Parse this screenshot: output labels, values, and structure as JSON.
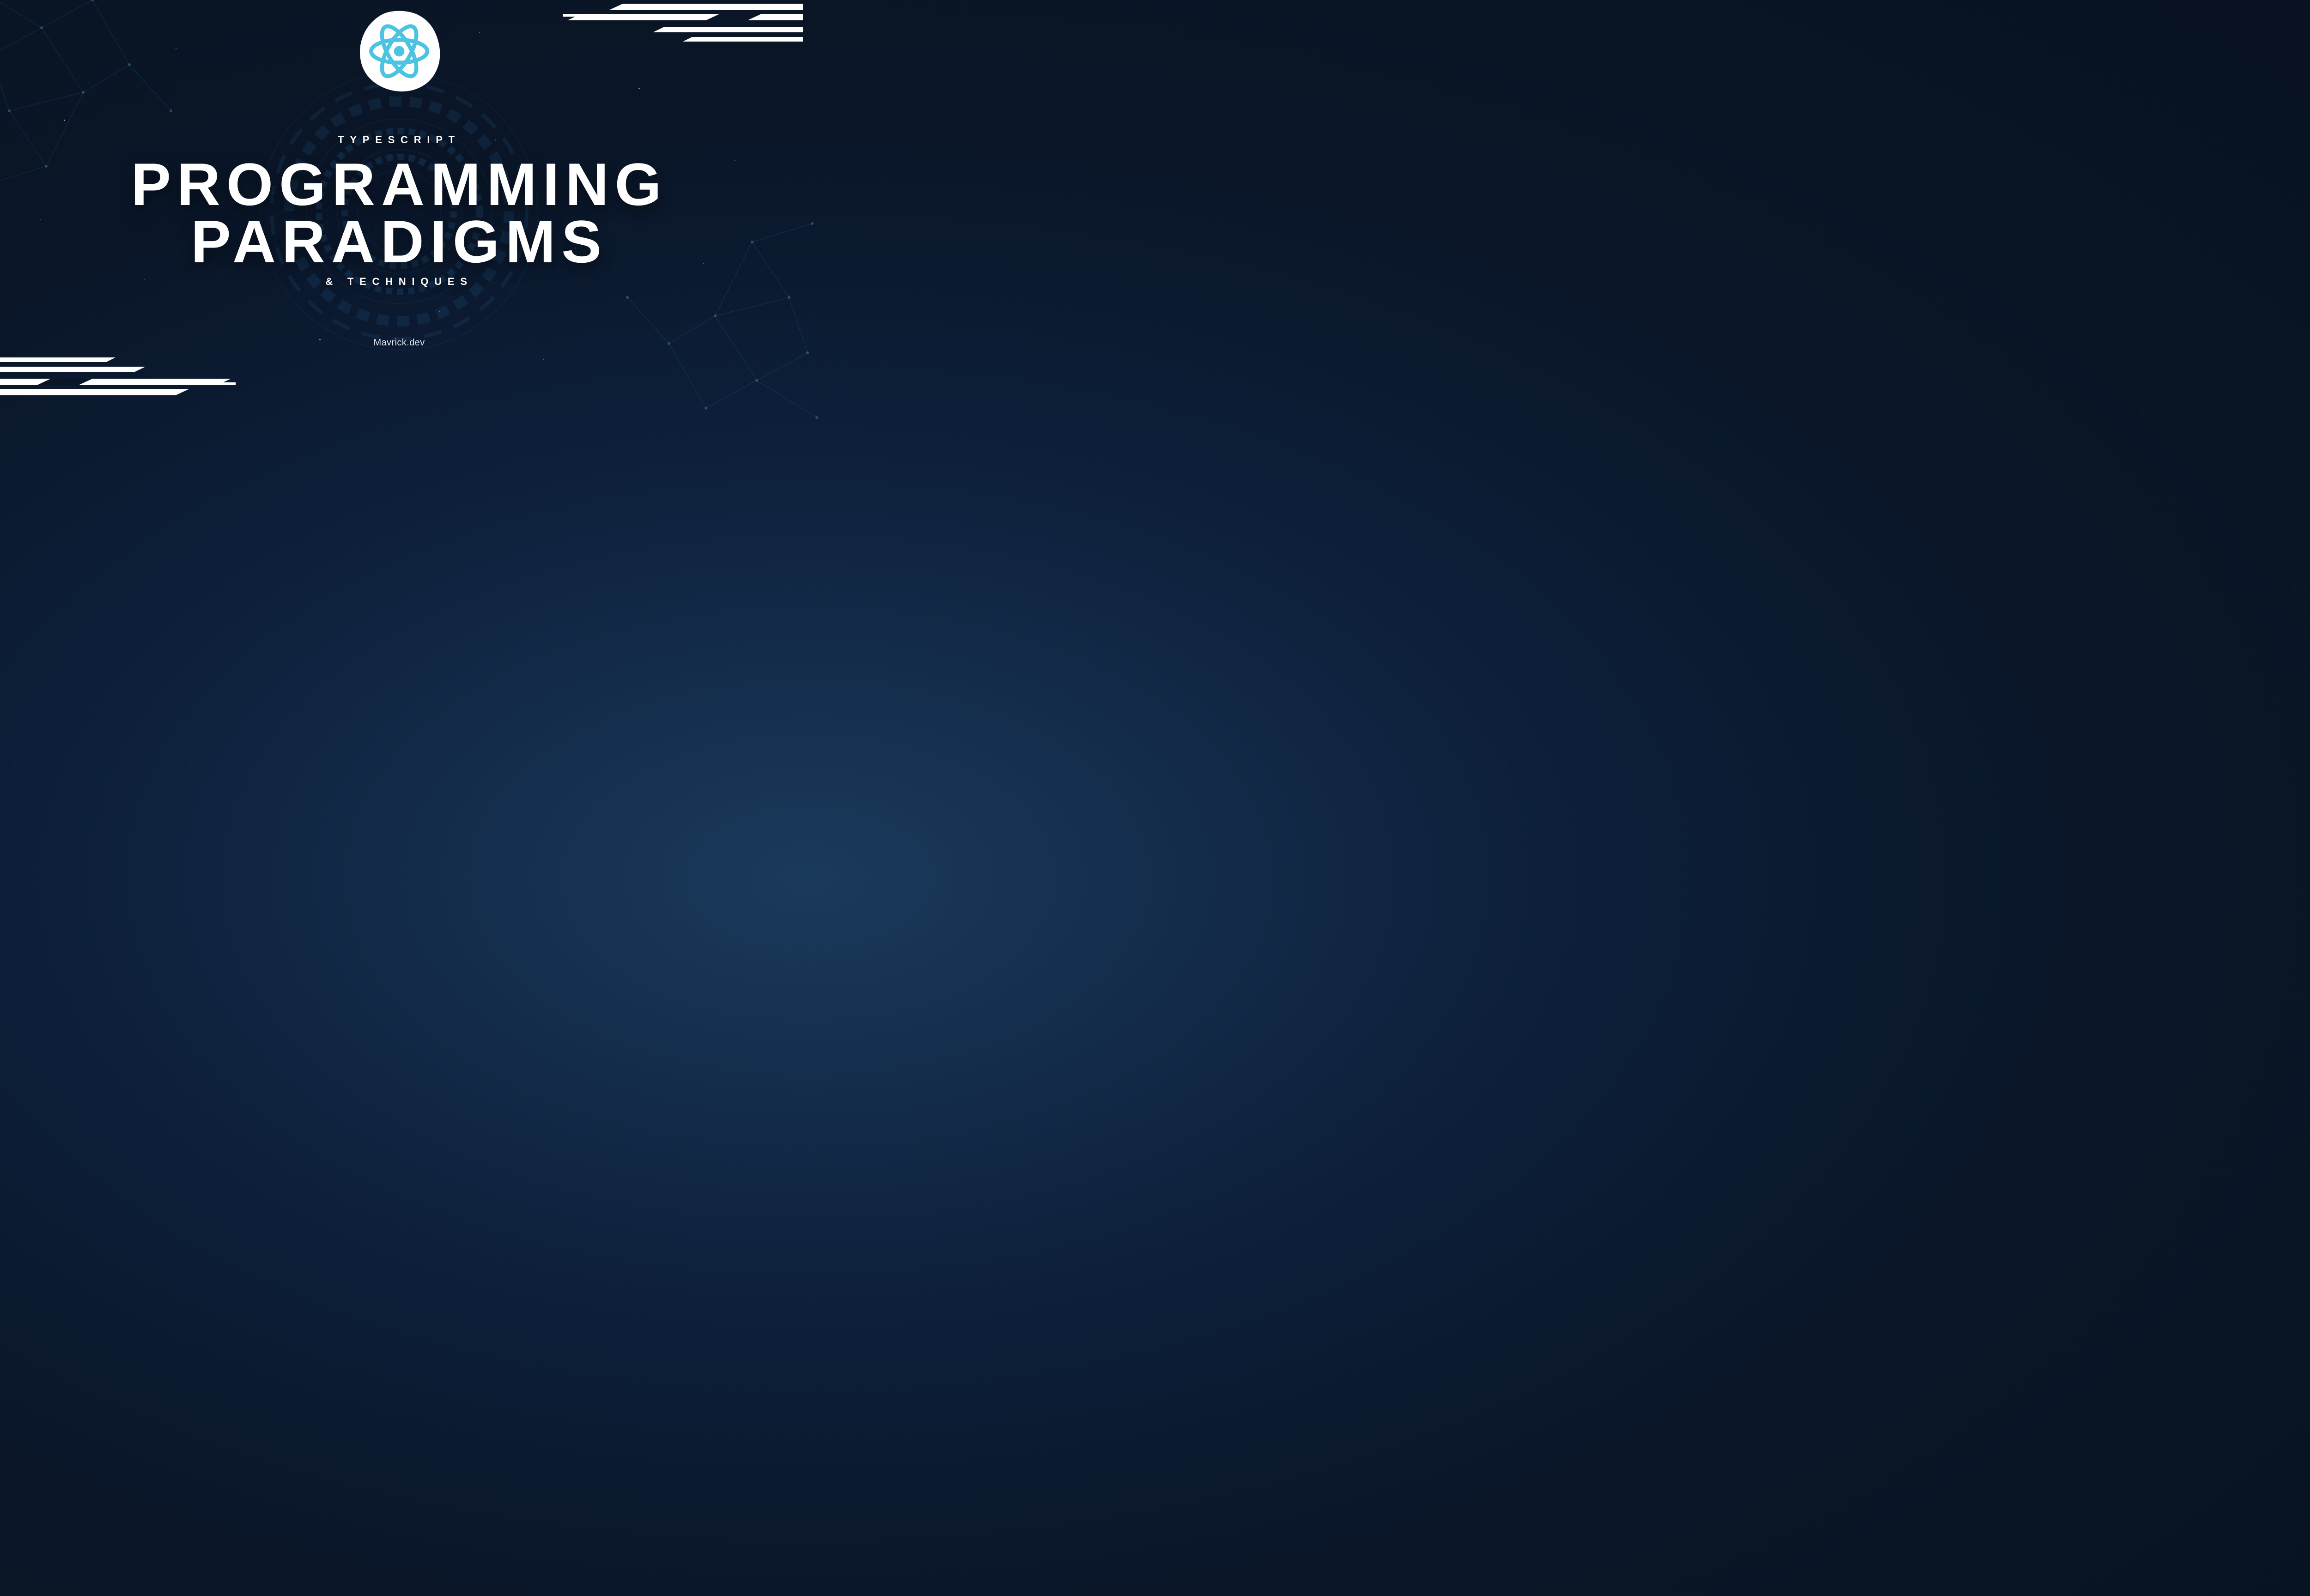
{
  "eyebrow": "TYPESCRIPT",
  "title_lines": [
    "PROGRAMMING",
    "PARADIGMS"
  ],
  "techniques": "& TECHNIQUES",
  "site": "Mavrick.dev",
  "logo_name": "react-logo",
  "colors": {
    "accent": "#4cc3e0",
    "bg_dark": "#0a1628"
  }
}
